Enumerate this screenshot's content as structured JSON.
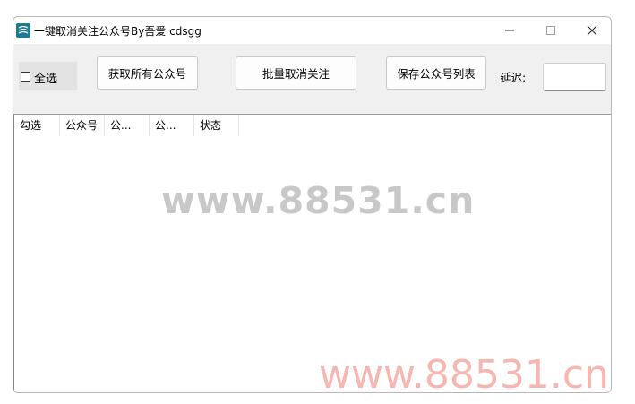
{
  "window": {
    "title": "一键取消关注公众号By吾爱 cdsgg"
  },
  "toolbar": {
    "select_all_label": "全选",
    "select_all_checked": false,
    "fetch_button": "获取所有公众号",
    "unfollow_button": "批量取消关注",
    "save_button": "保存公众号列表",
    "delay_label": "延迟:",
    "delay_value": ""
  },
  "list": {
    "columns": [
      "勾选",
      "公众号",
      "公...",
      "公...",
      "状态"
    ],
    "rows": []
  },
  "watermark": {
    "center": "www.88531.cn",
    "corner": "www.88531.cn"
  },
  "colors": {
    "accent_icon": "#1e7a91",
    "watermark_gray": "#c8c8c8",
    "watermark_pink": "#f6b7b2"
  }
}
